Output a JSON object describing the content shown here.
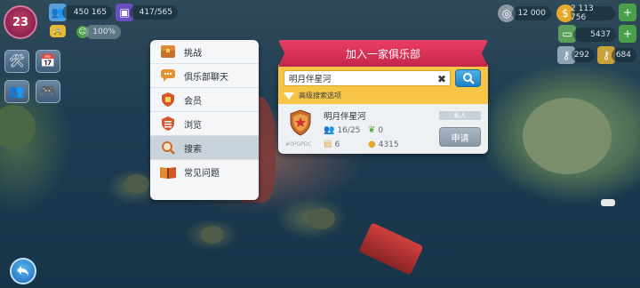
{
  "hud": {
    "level": "23",
    "population": "450 165",
    "storage": "417/565",
    "happiness": "100%",
    "silver": "12 000",
    "coins": "2 113 756",
    "cash": "5437",
    "keys_golden": "292",
    "keys_platinum": "684"
  },
  "menu": {
    "items": [
      {
        "label": "挑战",
        "icon": "chest-icon"
      },
      {
        "label": "俱乐部聊天",
        "icon": "chat-bubble-icon"
      },
      {
        "label": "会员",
        "icon": "members-icon"
      },
      {
        "label": "浏览",
        "icon": "list-icon"
      },
      {
        "label": "搜索",
        "icon": "magnifier-icon"
      },
      {
        "label": "常见问题",
        "icon": "book-icon"
      }
    ],
    "active_index": 4
  },
  "club_panel": {
    "title": "加入一家俱乐部",
    "search": {
      "value": "明月伴星河",
      "placeholder": ""
    },
    "advanced_label": "高级搜索选项",
    "result": {
      "name": "明月伴星河",
      "id": "#0PGPDC",
      "members": "16/25",
      "points": "0",
      "rank": "6",
      "coins": "4315",
      "type": "私人",
      "apply_label": "申请"
    }
  },
  "colors": {
    "ribbon": "#d93358",
    "search_band": "#f6c545",
    "search_button": "#2b8fd4",
    "apply_button": "#97a6b3"
  }
}
